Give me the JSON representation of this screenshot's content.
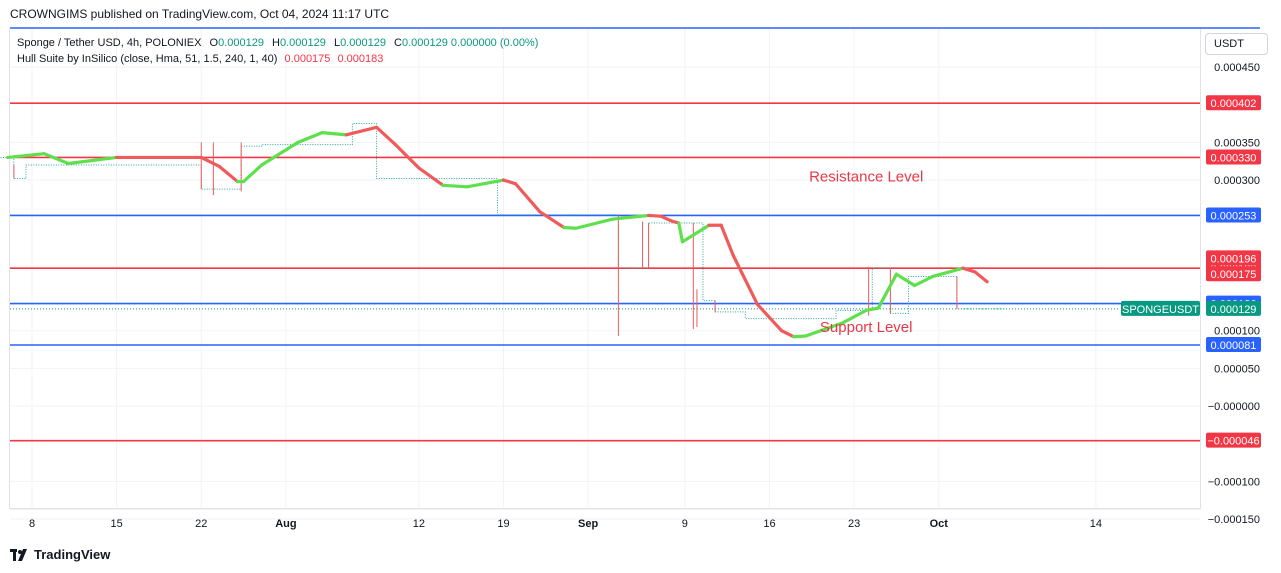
{
  "header": {
    "published": "CROWNGIMS published on TradingView.com, Oct 04, 2024 11:17 UTC"
  },
  "legend": {
    "symbol": "Sponge / Tether USD, 4h, POLONIEX",
    "o_label": "O",
    "o_val": "0.000129",
    "h_label": "H",
    "h_val": "0.000129",
    "l_label": "L",
    "l_val": "0.000129",
    "c_label": "C",
    "c_val": "0.000129",
    "change": "0.000000 (0.00%)",
    "indicator": "Hull Suite by InSilico (close, Hma, 51, 1.5, 240, 1, 40)",
    "ind_a": "0.000175",
    "ind_b": "0.000183"
  },
  "footer": {
    "brand": "TradingView"
  },
  "colors": {
    "red": "#f23645",
    "blue": "#2962ff",
    "green": "#089981",
    "hull_up": "#5ee04d",
    "hull_down": "#f05a5a"
  },
  "chart_data": {
    "type": "line",
    "currency": "USDT",
    "ylim": [
      -0.00015,
      0.00047
    ],
    "y_ticks": [
      {
        "v": 0.00045,
        "t": "0.000450"
      },
      {
        "v": 0.00035,
        "t": "0.000350"
      },
      {
        "v": 0.0003,
        "t": "0.000300"
      },
      {
        "v": 0.0001,
        "t": "0.000100"
      },
      {
        "v": 5e-05,
        "t": "0.000050"
      },
      {
        "v": 0.0,
        "t": "−0.000000"
      },
      {
        "v": -0.0001,
        "t": "−0.000100"
      },
      {
        "v": -0.00015,
        "t": "−0.000150"
      }
    ],
    "x_ticks": [
      {
        "day": 8,
        "t": "8",
        "bold": false
      },
      {
        "day": 15,
        "t": "15",
        "bold": false
      },
      {
        "day": 22,
        "t": "22",
        "bold": false
      },
      {
        "day": 29,
        "t": "Aug",
        "bold": true
      },
      {
        "day": 40,
        "t": "12",
        "bold": false
      },
      {
        "day": 47,
        "t": "19",
        "bold": false
      },
      {
        "day": 54,
        "t": "Sep",
        "bold": true
      },
      {
        "day": 62,
        "t": "9",
        "bold": false
      },
      {
        "day": 69,
        "t": "16",
        "bold": false
      },
      {
        "day": 76,
        "t": "23",
        "bold": false
      },
      {
        "day": 83,
        "t": "Oct",
        "bold": true
      },
      {
        "day": 96,
        "t": "14",
        "bold": false
      }
    ],
    "levels": [
      {
        "value": 0.000402,
        "label": "0.000402",
        "color": "red"
      },
      {
        "value": 0.00033,
        "label": "0.000330",
        "color": "red"
      },
      {
        "value": 0.000253,
        "label": "0.000253",
        "color": "blue"
      },
      {
        "value": 0.000183,
        "label": "0.000183",
        "color": "red"
      },
      {
        "value": 0.000136,
        "label": "0.000136",
        "color": "blue"
      },
      {
        "value": 8.1e-05,
        "label": "0.000081",
        "color": "blue"
      },
      {
        "value": -4.6e-05,
        "label": "−0.000046",
        "color": "red"
      }
    ],
    "top_line": 0.00048,
    "price_tags": [
      {
        "value": 0.000196,
        "label": "0.000196",
        "color": "red"
      },
      {
        "value": 0.000175,
        "label": "0.000175",
        "color": "red"
      }
    ],
    "last_price": {
      "value": 0.000129,
      "label": "0.000129",
      "symbol": "SPONGEUSDT"
    },
    "annotations": [
      {
        "text": "Resistance Level",
        "day": 77,
        "value": 0.000298
      },
      {
        "text": "Support Level",
        "day": 77,
        "value": 9.8e-05
      }
    ],
    "hull": [
      {
        "day": 6.0,
        "v": 0.00033,
        "trend": "up"
      },
      {
        "day": 9.0,
        "v": 0.000335,
        "trend": "up"
      },
      {
        "day": 11.0,
        "v": 0.000322,
        "trend": "up"
      },
      {
        "day": 15.0,
        "v": 0.00033,
        "trend": "up"
      },
      {
        "day": 22.0,
        "v": 0.00033,
        "trend": "down"
      },
      {
        "day": 23.5,
        "v": 0.000318,
        "trend": "down"
      },
      {
        "day": 25.0,
        "v": 0.000298,
        "trend": "down"
      },
      {
        "day": 25.5,
        "v": 0.000298,
        "trend": "up"
      },
      {
        "day": 27.0,
        "v": 0.00032,
        "trend": "up"
      },
      {
        "day": 30.0,
        "v": 0.00035,
        "trend": "up"
      },
      {
        "day": 32.0,
        "v": 0.000363,
        "trend": "up"
      },
      {
        "day": 34.0,
        "v": 0.00036,
        "trend": "up"
      },
      {
        "day": 36.5,
        "v": 0.00037,
        "trend": "down"
      },
      {
        "day": 38.0,
        "v": 0.000348,
        "trend": "down"
      },
      {
        "day": 40.0,
        "v": 0.000316,
        "trend": "down"
      },
      {
        "day": 42.0,
        "v": 0.000293,
        "trend": "down"
      },
      {
        "day": 44.0,
        "v": 0.000291,
        "trend": "up"
      },
      {
        "day": 47.0,
        "v": 0.0003,
        "trend": "up"
      },
      {
        "day": 48.0,
        "v": 0.000295,
        "trend": "down"
      },
      {
        "day": 50.0,
        "v": 0.000258,
        "trend": "down"
      },
      {
        "day": 52.0,
        "v": 0.000237,
        "trend": "down"
      },
      {
        "day": 53.0,
        "v": 0.000236,
        "trend": "up"
      },
      {
        "day": 56.0,
        "v": 0.000248,
        "trend": "up"
      },
      {
        "day": 59.0,
        "v": 0.000253,
        "trend": "up"
      },
      {
        "day": 60.0,
        "v": 0.000252,
        "trend": "down"
      },
      {
        "day": 61.0,
        "v": 0.000245,
        "trend": "down"
      },
      {
        "day": 61.5,
        "v": 0.000243,
        "trend": "down"
      },
      {
        "day": 61.8,
        "v": 0.000218,
        "trend": "up"
      },
      {
        "day": 64.0,
        "v": 0.00024,
        "trend": "up"
      },
      {
        "day": 65.0,
        "v": 0.00024,
        "trend": "down"
      },
      {
        "day": 66.0,
        "v": 0.0002,
        "trend": "down"
      },
      {
        "day": 68.0,
        "v": 0.000135,
        "trend": "down"
      },
      {
        "day": 70.0,
        "v": 0.0001,
        "trend": "down"
      },
      {
        "day": 71.0,
        "v": 9.2e-05,
        "trend": "down"
      },
      {
        "day": 72.0,
        "v": 9.3e-05,
        "trend": "up"
      },
      {
        "day": 75.0,
        "v": 0.00011,
        "trend": "up"
      },
      {
        "day": 77.0,
        "v": 0.000127,
        "trend": "up"
      },
      {
        "day": 78.0,
        "v": 0.00013,
        "trend": "up"
      },
      {
        "day": 79.5,
        "v": 0.000175,
        "trend": "up"
      },
      {
        "day": 81.0,
        "v": 0.00016,
        "trend": "up"
      },
      {
        "day": 82.5,
        "v": 0.000172,
        "trend": "up"
      },
      {
        "day": 85.0,
        "v": 0.000183,
        "trend": "up"
      },
      {
        "day": 86.0,
        "v": 0.000178,
        "trend": "down"
      },
      {
        "day": 87.0,
        "v": 0.000165,
        "trend": "down"
      }
    ],
    "steps": [
      [
        2.5,
        0.00033
      ],
      [
        6.5,
        0.00033
      ],
      [
        6.5,
        0.000302
      ],
      [
        7.5,
        0.000302
      ],
      [
        7.5,
        0.00032
      ],
      [
        22.0,
        0.00032
      ],
      [
        22.0,
        0.000288
      ],
      [
        25.3,
        0.000288
      ],
      [
        25.3,
        0.000345
      ],
      [
        27.0,
        0.000345
      ],
      [
        27.0,
        0.000347
      ],
      [
        34.5,
        0.000347
      ],
      [
        34.5,
        0.000375
      ],
      [
        36.5,
        0.000375
      ],
      [
        36.5,
        0.000302
      ],
      [
        46.5,
        0.000302
      ],
      [
        46.5,
        0.000254
      ],
      [
        56.5,
        0.000254
      ],
      [
        56.5,
        0.000183
      ],
      [
        59.0,
        0.000183
      ],
      [
        59.0,
        0.000243
      ],
      [
        63.5,
        0.000243
      ],
      [
        63.5,
        0.00014
      ],
      [
        64.5,
        0.00014
      ],
      [
        64.5,
        0.000125
      ],
      [
        67.0,
        0.000125
      ],
      [
        67.0,
        0.000116
      ],
      [
        74.5,
        0.000116
      ],
      [
        74.5,
        0.000127
      ],
      [
        77.5,
        0.000127
      ],
      [
        77.5,
        0.000183
      ],
      [
        79.0,
        0.000183
      ],
      [
        79.0,
        0.000123
      ],
      [
        80.5,
        0.000123
      ],
      [
        80.5,
        0.000172
      ],
      [
        84.5,
        0.000172
      ],
      [
        84.5,
        0.000129
      ],
      [
        88.5,
        0.000129
      ]
    ],
    "wicks": [
      [
        6.5,
        0.00032,
        0.000302
      ],
      [
        22.0,
        0.00035,
        0.000288
      ],
      [
        23.0,
        0.00035,
        0.00028
      ],
      [
        25.3,
        0.00035,
        0.000285
      ],
      [
        56.5,
        0.000254,
        9.3e-05
      ],
      [
        58.5,
        0.000245,
        0.000183
      ],
      [
        59.0,
        0.000243,
        0.000183
      ],
      [
        62.7,
        0.000243,
        0.000102
      ],
      [
        63.0,
        0.000155,
        0.000105
      ],
      [
        64.5,
        0.00014,
        0.000125
      ],
      [
        77.2,
        0.000185,
        0.00012
      ],
      [
        79.0,
        0.000183,
        0.000123
      ],
      [
        84.5,
        0.000172,
        0.000129
      ]
    ]
  }
}
